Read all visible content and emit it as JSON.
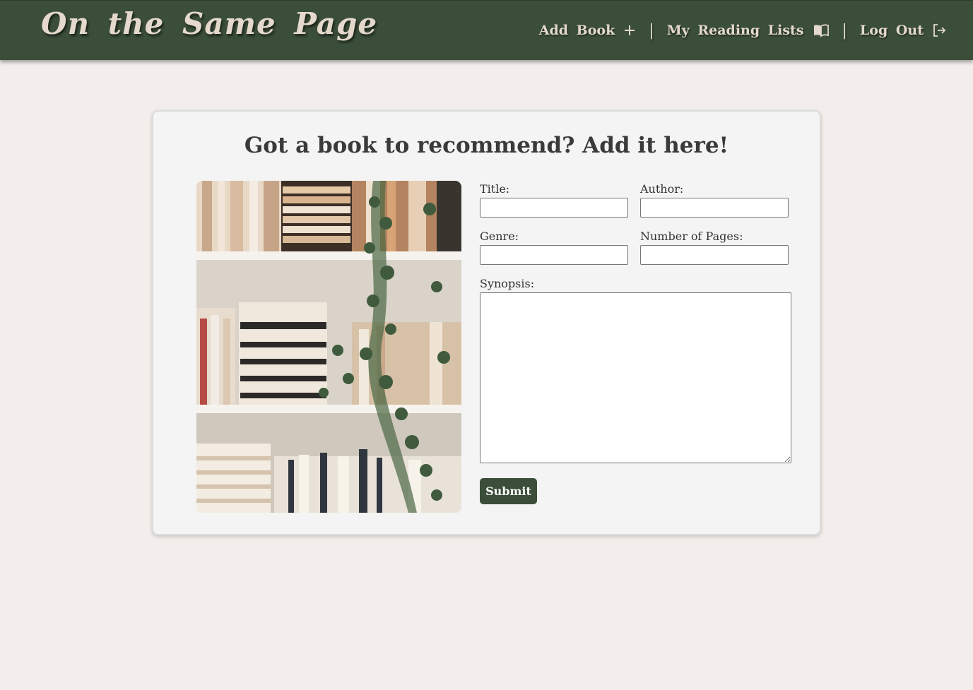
{
  "navbar": {
    "brand": "On the Same Page",
    "links": [
      {
        "label": "Add Book",
        "icon": "plus-icon"
      },
      {
        "label": "My Reading Lists",
        "icon": "open-book-icon"
      },
      {
        "label": "Log Out",
        "icon": "logout-icon"
      }
    ],
    "separator": "|"
  },
  "form": {
    "heading": "Got a book to recommend? Add it here!",
    "fields": {
      "title": {
        "label": "Title:",
        "value": ""
      },
      "author": {
        "label": "Author:",
        "value": ""
      },
      "genre": {
        "label": "Genre:",
        "value": ""
      },
      "pages": {
        "label": "Number of Pages:",
        "value": ""
      },
      "synopsis": {
        "label": "Synopsis:",
        "value": ""
      }
    },
    "submit_label": "Submit"
  },
  "colors": {
    "brand_green": "#3b4e39",
    "page_background": "#f3eeeb",
    "nav_text": "#e4d9cc"
  }
}
